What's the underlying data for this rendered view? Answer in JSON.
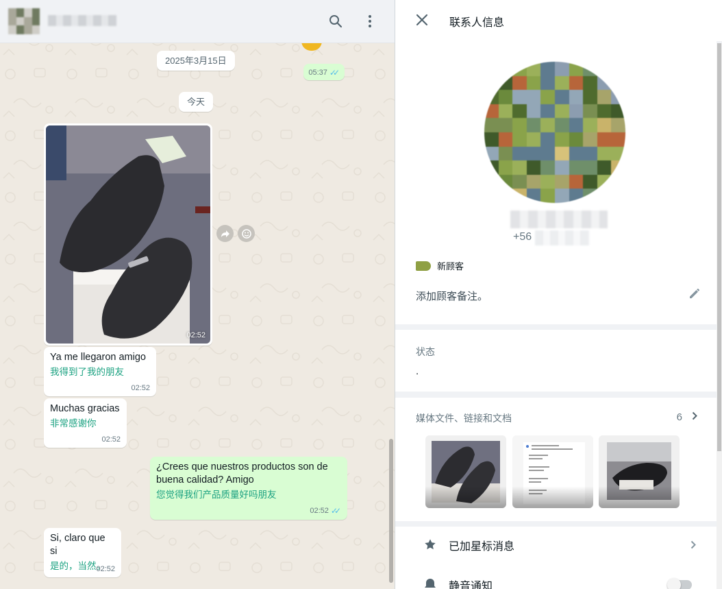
{
  "chat": {
    "messages": [
      {
        "kind": "time-only",
        "dir": "out",
        "time": "05:37"
      },
      {
        "kind": "date",
        "label": "2025年3月15日"
      },
      {
        "kind": "date",
        "label": "今天"
      },
      {
        "kind": "image",
        "dir": "in",
        "time": "02:52"
      },
      {
        "kind": "text",
        "dir": "in",
        "text": "Ya me llegaron amigo",
        "translation": "我得到了我的朋友",
        "time": "02:52"
      },
      {
        "kind": "text",
        "dir": "in",
        "text": "Muchas gracias",
        "translation": "非常感谢你",
        "time": "02:52"
      },
      {
        "kind": "text",
        "dir": "out",
        "text": "¿Crees que nuestros productos son de buena calidad? Amigo",
        "translation": "您觉得我们产品质量好吗朋友",
        "time": "02:52"
      },
      {
        "kind": "text",
        "dir": "in",
        "text": "Si, claro que si",
        "translation": "是的，当然。",
        "time": "02:52"
      }
    ]
  },
  "contact": {
    "title": "联系人信息",
    "phone_prefix": "+56",
    "label": "新顾客",
    "label_color": "#8fa044",
    "note_placeholder": "添加顾客备注。",
    "status_label": "状态",
    "status_value": ".",
    "media_label": "媒体文件、链接和文档",
    "media_count": "6",
    "starred_label": "已加星标消息",
    "mute_label": "静音通知"
  },
  "colors": {
    "accent": "#1aa180",
    "outgoing_bubble": "#d9fdd3",
    "tick": "#53bdeb"
  }
}
